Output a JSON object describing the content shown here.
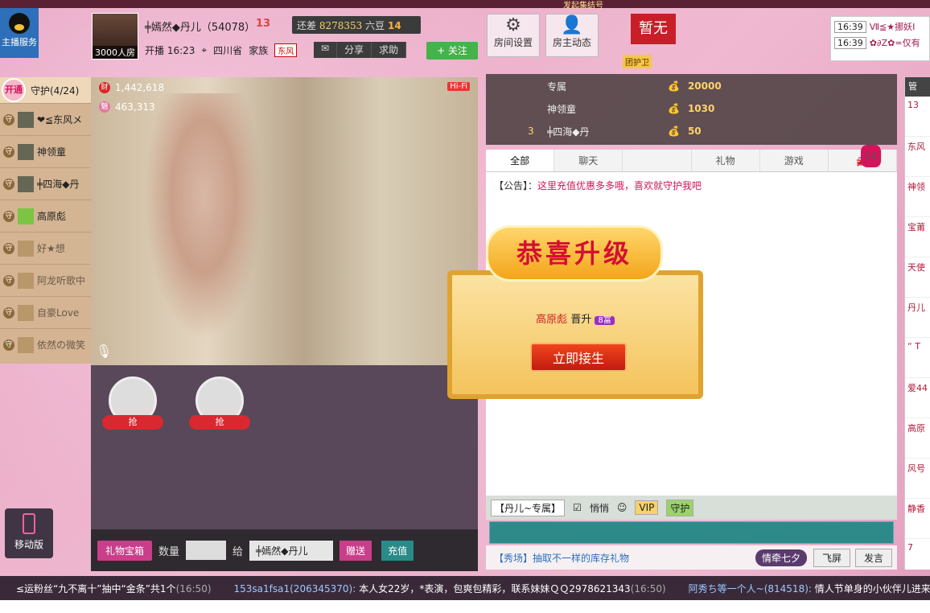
{
  "service": {
    "label": "主播服务"
  },
  "top_banner": {
    "text": "发起集结号"
  },
  "host": {
    "fans": "3000人房",
    "name": "╪嫣然◆丹儿（54078）",
    "level": "13",
    "diff_prefix": "还差",
    "diff_num": "8278353",
    "diff_suffix": "六豆",
    "diff_level": "14",
    "start": "开播 16:23",
    "location": "四川省",
    "clan_label": "家族",
    "clan": "东风",
    "mail_label": "",
    "share": "分享",
    "help": "求助",
    "follow": "+ 关注"
  },
  "big_buttons": [
    {
      "icon": "⚙",
      "label": "房间设置"
    },
    {
      "icon": "👤",
      "label": "房主动态"
    }
  ],
  "no_host": "暂无",
  "guard_badge": "团护卫",
  "ticker": [
    {
      "time": "16:39",
      "text": "Ⅶ≦★挪妖Ⅰ"
    },
    {
      "time": "16:39",
      "text": "✿∂Z✿=仅有"
    }
  ],
  "guard": {
    "open": "开通",
    "title": "守护(4/24)",
    "items": [
      {
        "name": "❤≦东风メ",
        "dim": false
      },
      {
        "name": "神领童",
        "dim": false
      },
      {
        "name": "╪四海◆丹",
        "dim": false
      },
      {
        "name": "高原彪",
        "dim": false
      },
      {
        "name": "好★想",
        "dim": true
      },
      {
        "name": "阿龙听歌中",
        "dim": true
      },
      {
        "name": "自豪Love",
        "dim": true
      },
      {
        "name": "依然の微笑",
        "dim": true
      }
    ]
  },
  "video": {
    "stat1": "1,442,618",
    "stat2": "463,313",
    "hifi": "Hi-Fi"
  },
  "seats": {
    "grab": "抢"
  },
  "gift_bar": {
    "box": "礼物宝箱",
    "qty_label": "数量",
    "to_label": "给",
    "to": "╪嫣然◆丹儿",
    "send": "赠送",
    "pay": "充值"
  },
  "mobile": "移动版",
  "rank": [
    {
      "no": "",
      "name": "专属",
      "coin": "20000"
    },
    {
      "no": "",
      "name": "神领童",
      "coin": "1030"
    },
    {
      "no": "3",
      "name": "╪四海◆丹",
      "coin": "50"
    }
  ],
  "chat_tabs": [
    "全部",
    "聊天",
    "",
    "礼物",
    "游戏",
    ""
  ],
  "tab_count": "14",
  "notice": {
    "k": "【公告】：",
    "v": "这里充值优惠多多哦，喜欢就守护我吧"
  },
  "chat_tools": {
    "target": "【丹儿~专属】",
    "private": "悄悄",
    "vip": "VIP",
    "guard": "守护"
  },
  "chat_foot": {
    "promo": "【秀场】抽取不一样的库存礼物",
    "love": "情牵七夕",
    "fly": "飞屏",
    "say": "发言"
  },
  "side": {
    "head": "管",
    "items": [
      "13",
      "东风",
      "神领",
      "宝莆",
      "天使",
      "丹儿",
      "“ T",
      "爱44",
      "高原",
      "风号",
      "静香",
      "7"
    ]
  },
  "modal": {
    "title": "恭喜升级",
    "user": "高原彪",
    "text": "晋升",
    "level": "8富",
    "claim": "立即接生"
  },
  "marquee": [
    {
      "user": "",
      "text": "≤运粉丝“九不离十”抽中“金条”共1个",
      "time": "(16:50)"
    },
    {
      "user": "153sa1fsa1(206345370):",
      "text": "本人女22岁，*表演，包爽包精彩，联系妹妹ＱＱ2978621343",
      "time": "(16:50)"
    },
    {
      "user": "阿秀ち等一个人~(814518):",
      "text": "情人节单身的小伙伴儿进来",
      "time": ""
    }
  ]
}
